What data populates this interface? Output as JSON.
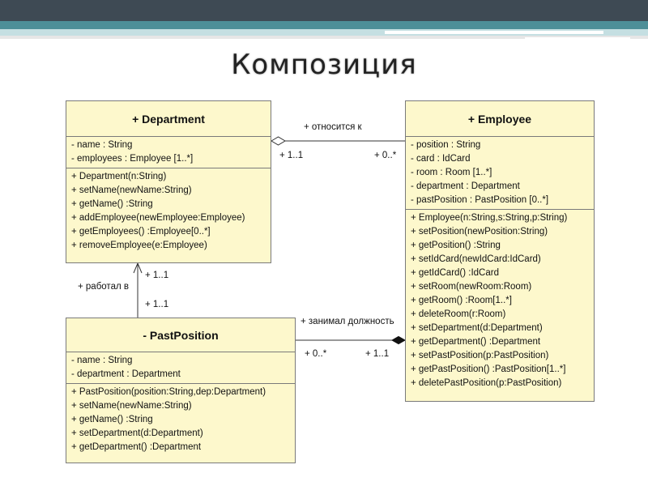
{
  "slide": {
    "title": "Композиция"
  },
  "classes": {
    "department": {
      "name": "+ Department",
      "attributes": [
        "- name : String",
        "- employees : Employee [1..*]"
      ],
      "operations": [
        "+ Department(n:String)",
        "+ setName(newName:String)",
        "+ getName() :String",
        "+ addEmployee(newEmployee:Employee)",
        "+ getEmployees() :Employee[0..*]",
        "+ removeEmployee(e:Employee)"
      ]
    },
    "employee": {
      "name": "+ Employee",
      "attributes": [
        "- position : String",
        "- card : IdCard",
        "- room : Room [1..*]",
        "- department : Department",
        "- pastPosition : PastPosition [0..*]"
      ],
      "operations": [
        "+ Employee(n:String,s:String,p:String)",
        "+ setPosition(newPosition:String)",
        "+ getPosition() :String",
        "+ setIdCard(newIdCard:IdCard)",
        "+ getIdCard() :IdCard",
        "+ setRoom(newRoom:Room)",
        "+ getRoom() :Room[1..*]",
        "+ deleteRoom(r:Room)",
        "+ setDepartment(d:Department)",
        "+ getDepartment() :Department",
        "+ setPastPosition(p:PastPosition)",
        "+ getPastPosition() :PastPosition[1..*]",
        "+ deletePastPosition(p:PastPosition)"
      ]
    },
    "pastposition": {
      "name": "- PastPosition",
      "attributes": [
        "- name : String",
        "- department : Department"
      ],
      "operations": [
        "+ PastPosition(position:String,dep:Department)",
        "+ setName(newName:String)",
        "+ getName() :String",
        "+ setDepartment(d:Department)",
        "+ getDepartment() :Department"
      ]
    }
  },
  "associations": {
    "dept_emp": {
      "label": "+ относится к",
      "mult_dept": "+  1..1",
      "mult_emp": "+  0..*"
    },
    "past_dept": {
      "label": "+ работал в",
      "mult_top": "+  1..1",
      "mult_bottom": "+  1..1"
    },
    "past_emp": {
      "label": "+ занимал должность",
      "mult_past": "+  0..*",
      "mult_emp": "+  1..1"
    }
  }
}
